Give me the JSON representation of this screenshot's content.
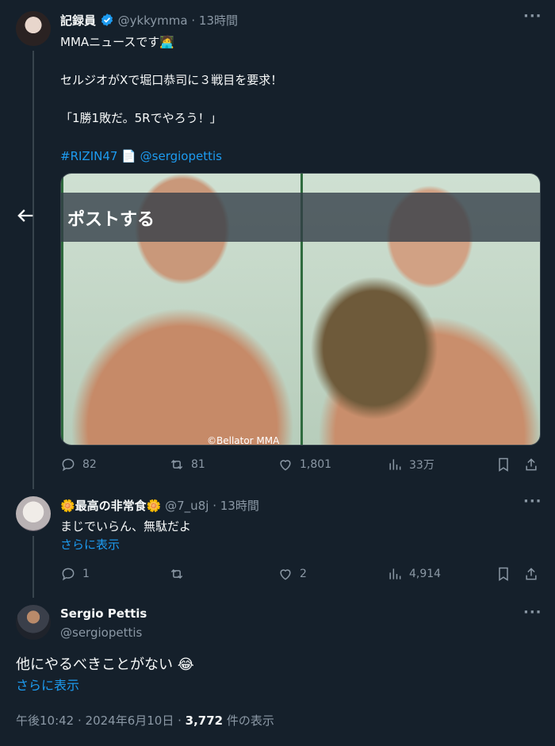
{
  "tweet1": {
    "display_name": "記録員",
    "handle": "@ykkymma",
    "time": "13時間",
    "line1": "MMAニュースです🧑‍💻",
    "line2": "セルジオがXで堀口恭司に３戦目を要求！",
    "line3": "「1勝1敗だ。5Rでやろう！」",
    "hashtag": "#RIZIN47",
    "doc_emoji": "📄",
    "mention": "@sergiopettis",
    "overlay_text": "ポストする",
    "credit": "©Bellator MMA",
    "actions": {
      "replies": "82",
      "reposts": "81",
      "likes": "1,801",
      "views": "33万"
    }
  },
  "tweet2": {
    "display_name": "🌼最高の非常食🌼",
    "handle": "@7_u8j",
    "time": "13時間",
    "text": "まじでいらん、無駄だよ",
    "show_more": "さらに表示",
    "actions": {
      "replies": "1",
      "reposts": "",
      "likes": "2",
      "views": "4,914"
    }
  },
  "tweet3": {
    "display_name": "Sergio Pettis",
    "handle": "@sergiopettis",
    "text": "他にやるべきことがない 😂",
    "show_more": "さらに表示",
    "timestamp": "午後10:42 · 2024年6月10日 · ",
    "views_count": "3,772",
    "views_label": " 件の表示"
  },
  "colors": {
    "background": "#15202b",
    "link": "#1d9bf0",
    "muted": "#8b98a5",
    "verified": "#1d9bf0"
  }
}
